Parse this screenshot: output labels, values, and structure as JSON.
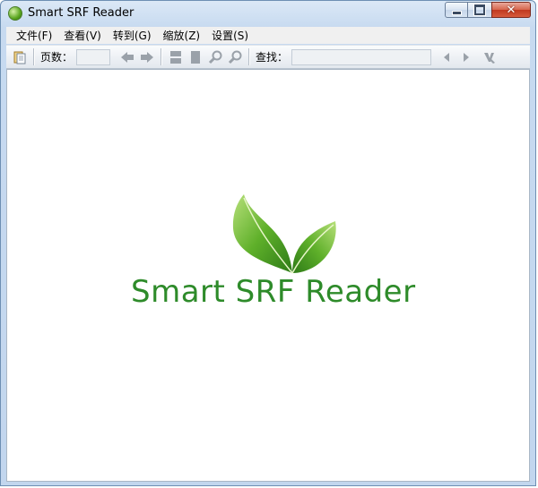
{
  "window": {
    "title": "Smart SRF Reader"
  },
  "menu": [
    "文件(F)",
    "查看(V)",
    "转到(G)",
    "缩放(Z)",
    "设置(S)"
  ],
  "toolbar": {
    "page_label": "页数：",
    "page_value": "",
    "find_label": "查找：",
    "find_value": ""
  },
  "splash": {
    "logo_text": "Smart SRF Reader"
  },
  "colors": {
    "logo_green": "#2e8b2a",
    "window_frame": "#c2d6ee"
  }
}
